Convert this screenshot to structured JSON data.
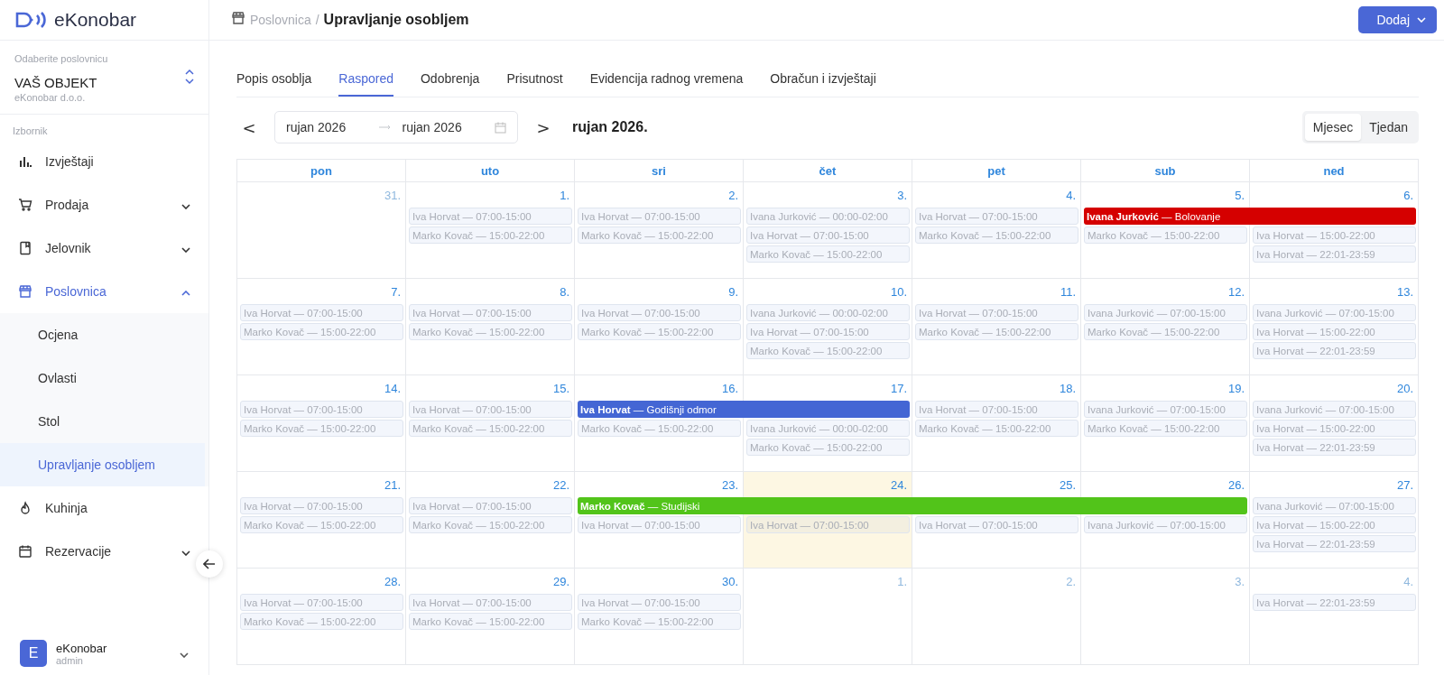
{
  "brand": {
    "name": "eKonobar"
  },
  "venue": {
    "caption": "Odaberite poslovnicu",
    "name": "VAŠ OBJEKT",
    "company": "eKonobar d.o.o."
  },
  "menu_caption": "Izbornik",
  "sidebar": {
    "items": [
      {
        "label": "Izvještaji",
        "kind": "link",
        "selected": false
      },
      {
        "label": "Prodaja",
        "kind": "group",
        "selected": false,
        "expanded": false
      },
      {
        "label": "Jelovnik",
        "kind": "group",
        "selected": false,
        "expanded": false
      },
      {
        "label": "Poslovnica",
        "kind": "group",
        "selected": true,
        "expanded": true,
        "children": [
          {
            "label": "Ocjena",
            "selected": false
          },
          {
            "label": "Ovlasti",
            "selected": false
          },
          {
            "label": "Stol",
            "selected": false
          },
          {
            "label": "Upravljanje osobljem",
            "selected": true
          }
        ]
      },
      {
        "label": "Kuhinja",
        "kind": "link",
        "selected": false
      },
      {
        "label": "Rezervacije",
        "kind": "group",
        "selected": false,
        "expanded": false
      }
    ]
  },
  "user": {
    "initial": "E",
    "name": "eKonobar",
    "role": "admin"
  },
  "breadcrumb": {
    "parent": "Poslovnica",
    "separator": "/",
    "current": "Upravljanje osobljem"
  },
  "add_button": "Dodaj",
  "tabs": [
    {
      "label": "Popis osoblja",
      "selected": false
    },
    {
      "label": "Raspored",
      "selected": true
    },
    {
      "label": "Odobrenja",
      "selected": false
    },
    {
      "label": "Prisutnost",
      "selected": false
    },
    {
      "label": "Evidencija radnog vremena",
      "selected": false
    },
    {
      "label": "Obračun i izvještaji",
      "selected": false
    }
  ],
  "date_range": {
    "prev": "<",
    "start": "rujan 2026",
    "end": "rujan 2026",
    "next": ">",
    "title": "rujan 2026."
  },
  "view_toggle": [
    {
      "label": "Mjesec",
      "selected": true
    },
    {
      "label": "Tjedan",
      "selected": false
    }
  ],
  "calendar": {
    "weekdays": [
      "pon",
      "uto",
      "sri",
      "čet",
      "pet",
      "sub",
      "ned"
    ],
    "weeks": [
      {
        "days": [
          {
            "number": "31.",
            "in_month": false,
            "today": false
          },
          {
            "number": "1.",
            "in_month": true,
            "today": false,
            "shifts": [
              "Iva Horvat — 07:00-15:00",
              "Marko Kovač — 15:00-22:00"
            ]
          },
          {
            "number": "2.",
            "in_month": true,
            "today": false,
            "shifts": [
              "Iva Horvat — 07:00-15:00",
              "Marko Kovač — 15:00-22:00"
            ]
          },
          {
            "number": "3.",
            "in_month": true,
            "today": false,
            "shifts": [
              "Ivana Jurković — 00:00-02:00",
              "Iva Horvat — 07:00-15:00",
              "Marko Kovač — 15:00-22:00"
            ]
          },
          {
            "number": "4.",
            "in_month": true,
            "today": false,
            "shifts": [
              "Iva Horvat — 07:00-15:00",
              "Marko Kovač — 15:00-22:00"
            ]
          },
          {
            "number": "5.",
            "in_month": true,
            "today": false,
            "absence": {
              "text": "**Ivana Jurković** — Bolovanje",
              "color": "#d50000"
            },
            "shifts": [
              "Marko Kovač — 15:00-22:00"
            ]
          },
          {
            "number": "6.",
            "in_month": true,
            "today": false,
            "absence_continues": true,
            "shifts": [
              "Iva Horvat — 15:00-22:00",
              "Iva Horvat — 22:01-23:59"
            ]
          }
        ]
      },
      {
        "days": [
          {
            "number": "7.",
            "in_month": true,
            "today": false,
            "shifts": [
              "Iva Horvat — 07:00-15:00",
              "Marko Kovač — 15:00-22:00"
            ]
          },
          {
            "number": "8.",
            "in_month": true,
            "today": false,
            "shifts": [
              "Iva Horvat — 07:00-15:00",
              "Marko Kovač — 15:00-22:00"
            ]
          },
          {
            "number": "9.",
            "in_month": true,
            "today": false,
            "shifts": [
              "Iva Horvat — 07:00-15:00",
              "Marko Kovač — 15:00-22:00"
            ]
          },
          {
            "number": "10.",
            "in_month": true,
            "today": false,
            "shifts": [
              "Ivana Jurković — 00:00-02:00",
              "Iva Horvat — 07:00-15:00",
              "Marko Kovač — 15:00-22:00"
            ]
          },
          {
            "number": "11.",
            "in_month": true,
            "today": false,
            "shifts": [
              "Iva Horvat — 07:00-15:00",
              "Marko Kovač — 15:00-22:00"
            ]
          },
          {
            "number": "12.",
            "in_month": true,
            "today": false,
            "shifts": [
              "Ivana Jurković — 07:00-15:00",
              "Marko Kovač — 15:00-22:00"
            ]
          },
          {
            "number": "13.",
            "in_month": true,
            "today": false,
            "shifts": [
              "Ivana Jurković — 07:00-15:00",
              "Iva Horvat — 15:00-22:00",
              "Iva Horvat — 22:01-23:59"
            ]
          }
        ]
      },
      {
        "days": [
          {
            "number": "14.",
            "in_month": true,
            "today": false,
            "shifts": [
              "Iva Horvat — 07:00-15:00",
              "Marko Kovač — 15:00-22:00"
            ]
          },
          {
            "number": "15.",
            "in_month": true,
            "today": false,
            "shifts": [
              "Iva Horvat — 07:00-15:00",
              "Marko Kovač — 15:00-22:00"
            ]
          },
          {
            "number": "16.",
            "in_month": true,
            "today": false,
            "absence": {
              "text": "**Iva Horvat** — Godišnji odmor",
              "color": "#4466d4"
            },
            "shifts": [
              "Marko Kovač — 15:00-22:00"
            ]
          },
          {
            "number": "17.",
            "in_month": true,
            "today": false,
            "absence_continues": true,
            "shifts": [
              "Ivana Jurković — 00:00-02:00",
              "Marko Kovač — 15:00-22:00"
            ]
          },
          {
            "number": "18.",
            "in_month": true,
            "today": false,
            "shifts": [
              "Iva Horvat — 07:00-15:00",
              "Marko Kovač — 15:00-22:00"
            ]
          },
          {
            "number": "19.",
            "in_month": true,
            "today": false,
            "shifts": [
              "Ivana Jurković — 07:00-15:00",
              "Marko Kovač — 15:00-22:00"
            ]
          },
          {
            "number": "20.",
            "in_month": true,
            "today": false,
            "shifts": [
              "Ivana Jurković — 07:00-15:00",
              "Iva Horvat — 15:00-22:00",
              "Iva Horvat — 22:01-23:59"
            ]
          }
        ]
      },
      {
        "days": [
          {
            "number": "21.",
            "in_month": true,
            "today": false,
            "shifts": [
              "Iva Horvat — 07:00-15:00",
              "Marko Kovač — 15:00-22:00"
            ]
          },
          {
            "number": "22.",
            "in_month": true,
            "today": false,
            "shifts": [
              "Iva Horvat — 07:00-15:00",
              "Marko Kovač — 15:00-22:00"
            ]
          },
          {
            "number": "23.",
            "in_month": true,
            "today": false,
            "absence": {
              "text": "**Marko Kovač** — Studijski",
              "color": "#52c41a"
            },
            "shifts": [
              "Iva Horvat — 07:00-15:00"
            ]
          },
          {
            "number": "24.",
            "in_month": true,
            "today": true,
            "absence_continues": true,
            "shifts": [
              "Iva Horvat — 07:00-15:00"
            ]
          },
          {
            "number": "25.",
            "in_month": true,
            "today": false,
            "absence_continues": true,
            "shifts": [
              "Iva Horvat — 07:00-15:00"
            ]
          },
          {
            "number": "26.",
            "in_month": true,
            "today": false,
            "absence_continues": true,
            "shifts": [
              "Ivana Jurković — 07:00-15:00"
            ]
          },
          {
            "number": "27.",
            "in_month": true,
            "today": false,
            "shifts": [
              "Ivana Jurković — 07:00-15:00",
              "Iva Horvat — 15:00-22:00",
              "Iva Horvat — 22:01-23:59"
            ]
          }
        ]
      },
      {
        "days": [
          {
            "number": "28.",
            "in_month": true,
            "today": false,
            "shifts": [
              "Iva Horvat — 07:00-15:00",
              "Marko Kovač — 15:00-22:00"
            ]
          },
          {
            "number": "29.",
            "in_month": true,
            "today": false,
            "shifts": [
              "Iva Horvat — 07:00-15:00",
              "Marko Kovač — 15:00-22:00"
            ]
          },
          {
            "number": "30.",
            "in_month": true,
            "today": false,
            "shifts": [
              "Iva Horvat — 07:00-15:00",
              "Marko Kovač — 15:00-22:00"
            ]
          },
          {
            "number": "1.",
            "in_month": false,
            "today": false
          },
          {
            "number": "2.",
            "in_month": false,
            "today": false
          },
          {
            "number": "3.",
            "in_month": false,
            "today": false
          },
          {
            "number": "4.",
            "in_month": false,
            "today": false,
            "shifts": [
              "Iva Horvat — 22:01-23:59"
            ]
          }
        ]
      }
    ]
  }
}
